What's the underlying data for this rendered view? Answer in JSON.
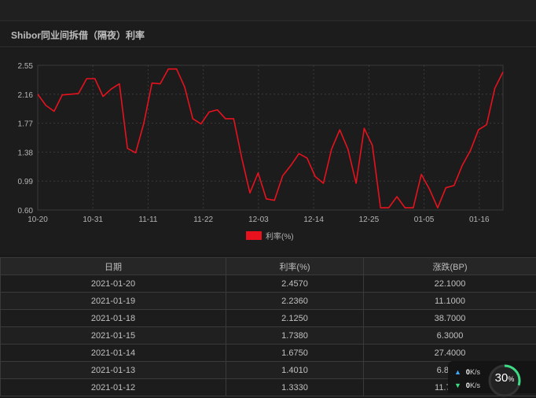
{
  "panel": {
    "title": "Shibor同业间拆借（隔夜）利率"
  },
  "chart_data": {
    "type": "line",
    "title": "Shibor同业间拆借（隔夜）利率",
    "ylim": [
      0.6,
      2.55
    ],
    "yticks": [
      "0.60",
      "0.99",
      "1.38",
      "1.77",
      "2.16",
      "2.55"
    ],
    "xticks": [
      "10-20",
      "10-31",
      "11-11",
      "11-22",
      "12-03",
      "12-14",
      "12-25",
      "01-05",
      "01-16"
    ],
    "grid": true,
    "legend_position": "bottom",
    "series": [
      {
        "name": "利率(%)",
        "color": "#e8121e",
        "values": [
          2.16,
          2.01,
          1.93,
          2.15,
          2.16,
          2.17,
          2.37,
          2.37,
          2.13,
          2.23,
          2.3,
          1.43,
          1.37,
          1.77,
          2.31,
          2.3,
          2.5,
          2.5,
          2.26,
          1.83,
          1.76,
          1.92,
          1.95,
          1.83,
          1.83,
          1.3,
          0.83,
          1.1,
          0.75,
          0.73,
          1.06,
          1.2,
          1.36,
          1.3,
          1.05,
          0.96,
          1.42,
          1.68,
          1.42,
          0.96,
          1.7,
          1.47,
          0.63,
          0.63,
          0.78,
          0.63,
          0.63,
          1.08,
          0.88,
          0.63,
          0.9,
          0.93,
          1.2,
          1.4,
          1.68,
          1.75,
          2.24,
          2.46
        ]
      }
    ]
  },
  "table": {
    "headers": [
      "日期",
      "利率(%)",
      "涨跌(BP)"
    ],
    "rows": [
      [
        "2021-01-20",
        "2.4570",
        "22.1000"
      ],
      [
        "2021-01-19",
        "2.2360",
        "11.1000"
      ],
      [
        "2021-01-18",
        "2.1250",
        "38.7000"
      ],
      [
        "2021-01-15",
        "1.7380",
        "6.3000"
      ],
      [
        "2021-01-14",
        "1.6750",
        "27.4000"
      ],
      [
        "2021-01-13",
        "1.4010",
        "6.8000"
      ],
      [
        "2021-01-12",
        "1.3330",
        "11.7000"
      ]
    ]
  },
  "overlay": {
    "upload_value": "0",
    "upload_unit": "K/s",
    "download_value": "0",
    "download_unit": "K/s",
    "percent_value": "30",
    "percent_unit": "%",
    "progress_fraction": 0.3
  }
}
